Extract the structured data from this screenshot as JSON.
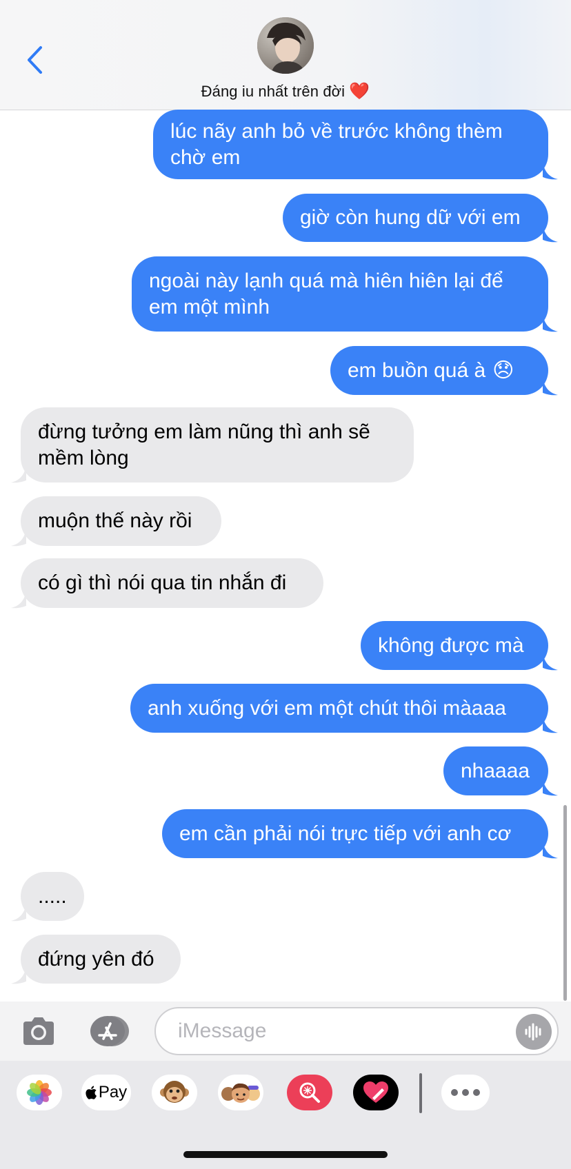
{
  "header": {
    "contact_name": "Đáng iu nhất trên đời",
    "name_emoji": "❤️"
  },
  "messages": [
    {
      "side": "sent",
      "text": "lúc nãy anh bỏ về trước không thèm\nchờ em"
    },
    {
      "side": "sent",
      "text": "giờ còn hung dữ với em"
    },
    {
      "side": "sent",
      "text": "ngoài này lạnh quá mà hiên hiên lại để\nem một mình"
    },
    {
      "side": "sent",
      "text": "em buồn quá à",
      "emoji": "😞"
    },
    {
      "side": "received",
      "text": "đừng tưởng em làm nũng thì anh sẽ\nmềm lòng"
    },
    {
      "side": "received",
      "text": "muộn thế này rồi"
    },
    {
      "side": "received",
      "text": "có gì thì nói qua tin nhắn đi"
    },
    {
      "side": "sent",
      "text": "không được mà"
    },
    {
      "side": "sent",
      "text": "anh xuống với em một chút thôi màaaa"
    },
    {
      "side": "sent",
      "text": "nhaaaa"
    },
    {
      "side": "sent",
      "text": "em cần phải nói trực tiếp với anh cơ"
    },
    {
      "side": "received",
      "text": "....."
    },
    {
      "side": "received",
      "text": "đứng yên đó"
    }
  ],
  "input": {
    "placeholder": "iMessage"
  },
  "app_drawer": {
    "apps": [
      {
        "name": "photos-app-icon"
      },
      {
        "name": "apple-pay-icon",
        "label": "Pay"
      },
      {
        "name": "animoji-monkey-icon"
      },
      {
        "name": "memoji-icon"
      },
      {
        "name": "image-search-icon"
      },
      {
        "name": "digital-touch-icon"
      },
      {
        "name": "more-apps-icon"
      }
    ]
  },
  "colors": {
    "sent_bubble": "#3a82f7",
    "received_bubble": "#e9e9eb",
    "accent": "#2f7bf6"
  }
}
